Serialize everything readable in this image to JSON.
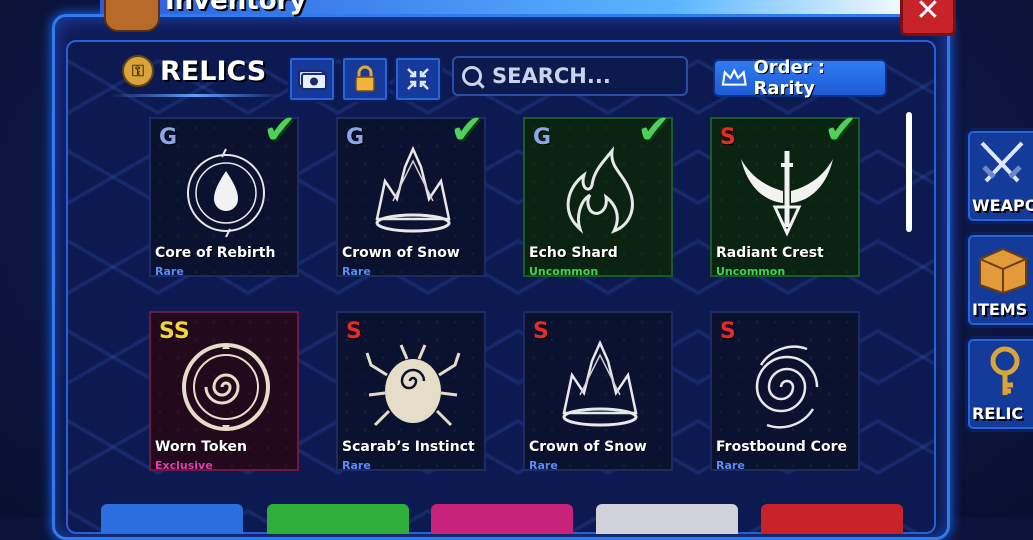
{
  "window": {
    "title": "Inventory",
    "close_label": "✕"
  },
  "header": {
    "title": "RELICS"
  },
  "search": {
    "placeholder": "SEARCH..."
  },
  "order": {
    "label": "Order : Rarity"
  },
  "colors": {
    "rare": "#5a8cff",
    "uncommon": "#3fd64a",
    "exclusive": "#e23cb0",
    "grade_g": "#8ea6e6",
    "grade_s": "#e32b2b",
    "grade_ss": "#f2d33a"
  },
  "cards": [
    {
      "grade": "G",
      "name": "Core of Rebirth",
      "rarity": "Rare",
      "checked": true,
      "icon": "droplet-icon"
    },
    {
      "grade": "G",
      "name": "Crown of Snow",
      "rarity": "Rare",
      "checked": true,
      "icon": "crown-icon"
    },
    {
      "grade": "G",
      "name": "Echo Shard",
      "rarity": "Uncommon",
      "checked": true,
      "icon": "flame-icon"
    },
    {
      "grade": "S",
      "name": "Radiant Crest",
      "rarity": "Uncommon",
      "checked": true,
      "icon": "winged-crest-icon"
    },
    {
      "grade": "SS",
      "name": "Worn Token",
      "rarity": "Exclusive",
      "checked": false,
      "icon": "spiral-token-icon"
    },
    {
      "grade": "S",
      "name": "Scarab’s Instinct",
      "rarity": "Rare",
      "checked": false,
      "icon": "scarab-icon"
    },
    {
      "grade": "S",
      "name": "Crown of Snow",
      "rarity": "Rare",
      "checked": false,
      "icon": "crown-icon"
    },
    {
      "grade": "S",
      "name": "Frostbound Core",
      "rarity": "Rare",
      "checked": false,
      "icon": "vortex-icon"
    }
  ],
  "side_tabs": [
    {
      "label": "WEAPO"
    },
    {
      "label": "ITEMS"
    },
    {
      "label": "RELIC"
    }
  ]
}
